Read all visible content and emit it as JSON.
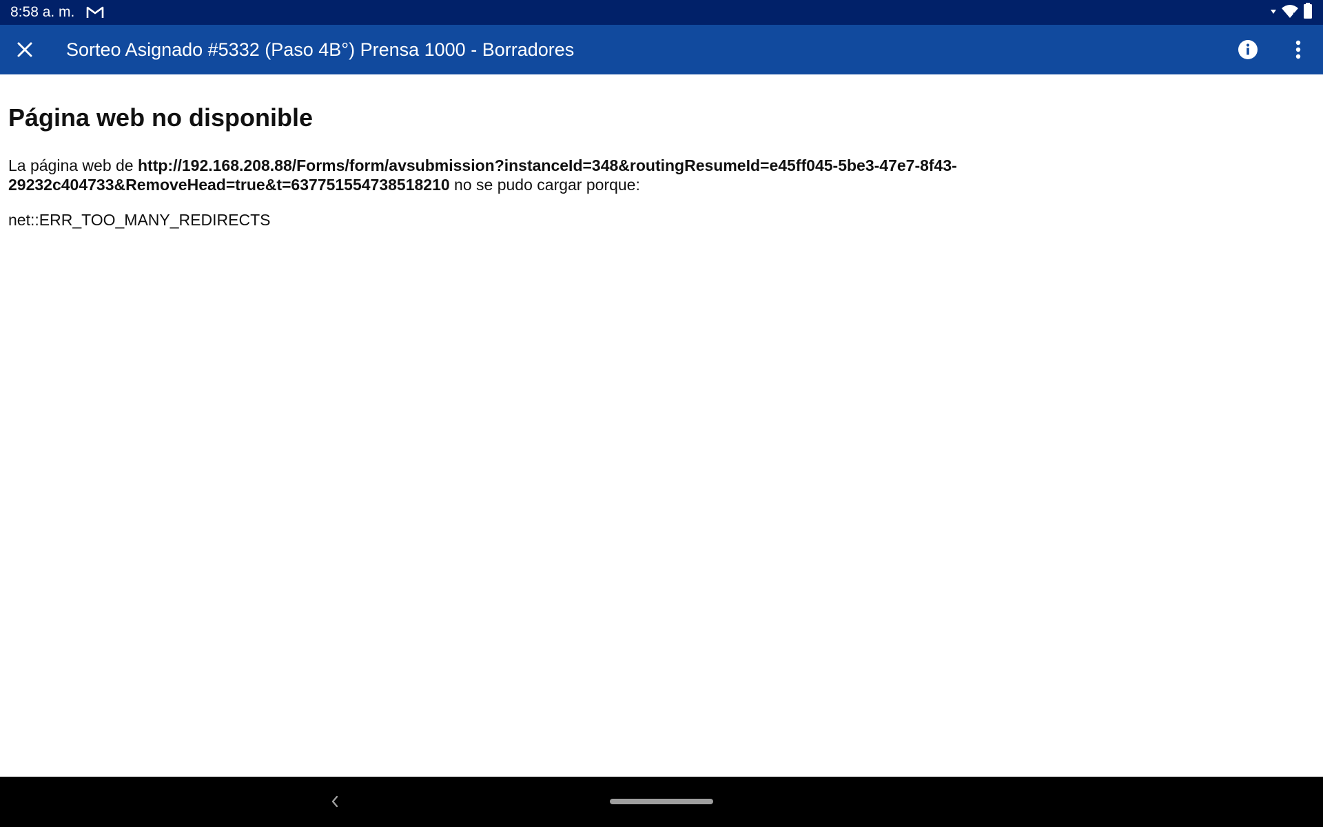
{
  "status_bar": {
    "time": "8:58 a. m.",
    "notification_icon": "gmail-icon",
    "right_icons": [
      "wifi-icon",
      "battery-icon"
    ]
  },
  "app_bar": {
    "title": "Sorteo Asignado #5332 (Paso 4B°) Prensa 1000 - Borradores",
    "close_icon": "close-icon",
    "info_icon": "info-icon",
    "more_icon": "more-vert-icon"
  },
  "error_page": {
    "icon": "android-icon",
    "title": "Página web no disponible",
    "desc_prefix": "La página web de ",
    "url": "http://192.168.208.88/Forms/form/avsubmission?instanceId=348&routingResumeId=e45ff045-5be3-47e7-8f43-29232c404733&RemoveHead=true&t=637751554738518210",
    "desc_suffix": " no se pudo cargar porque:",
    "error_code": "net::ERR_TOO_MANY_REDIRECTS"
  },
  "nav_bar": {
    "back_icon": "back-icon",
    "home_icon": "home-pill-icon"
  },
  "colors": {
    "status_bar": "#012169",
    "app_bar": "#114a9e",
    "android_green": "#a4c639",
    "nav_bar": "#000000"
  }
}
